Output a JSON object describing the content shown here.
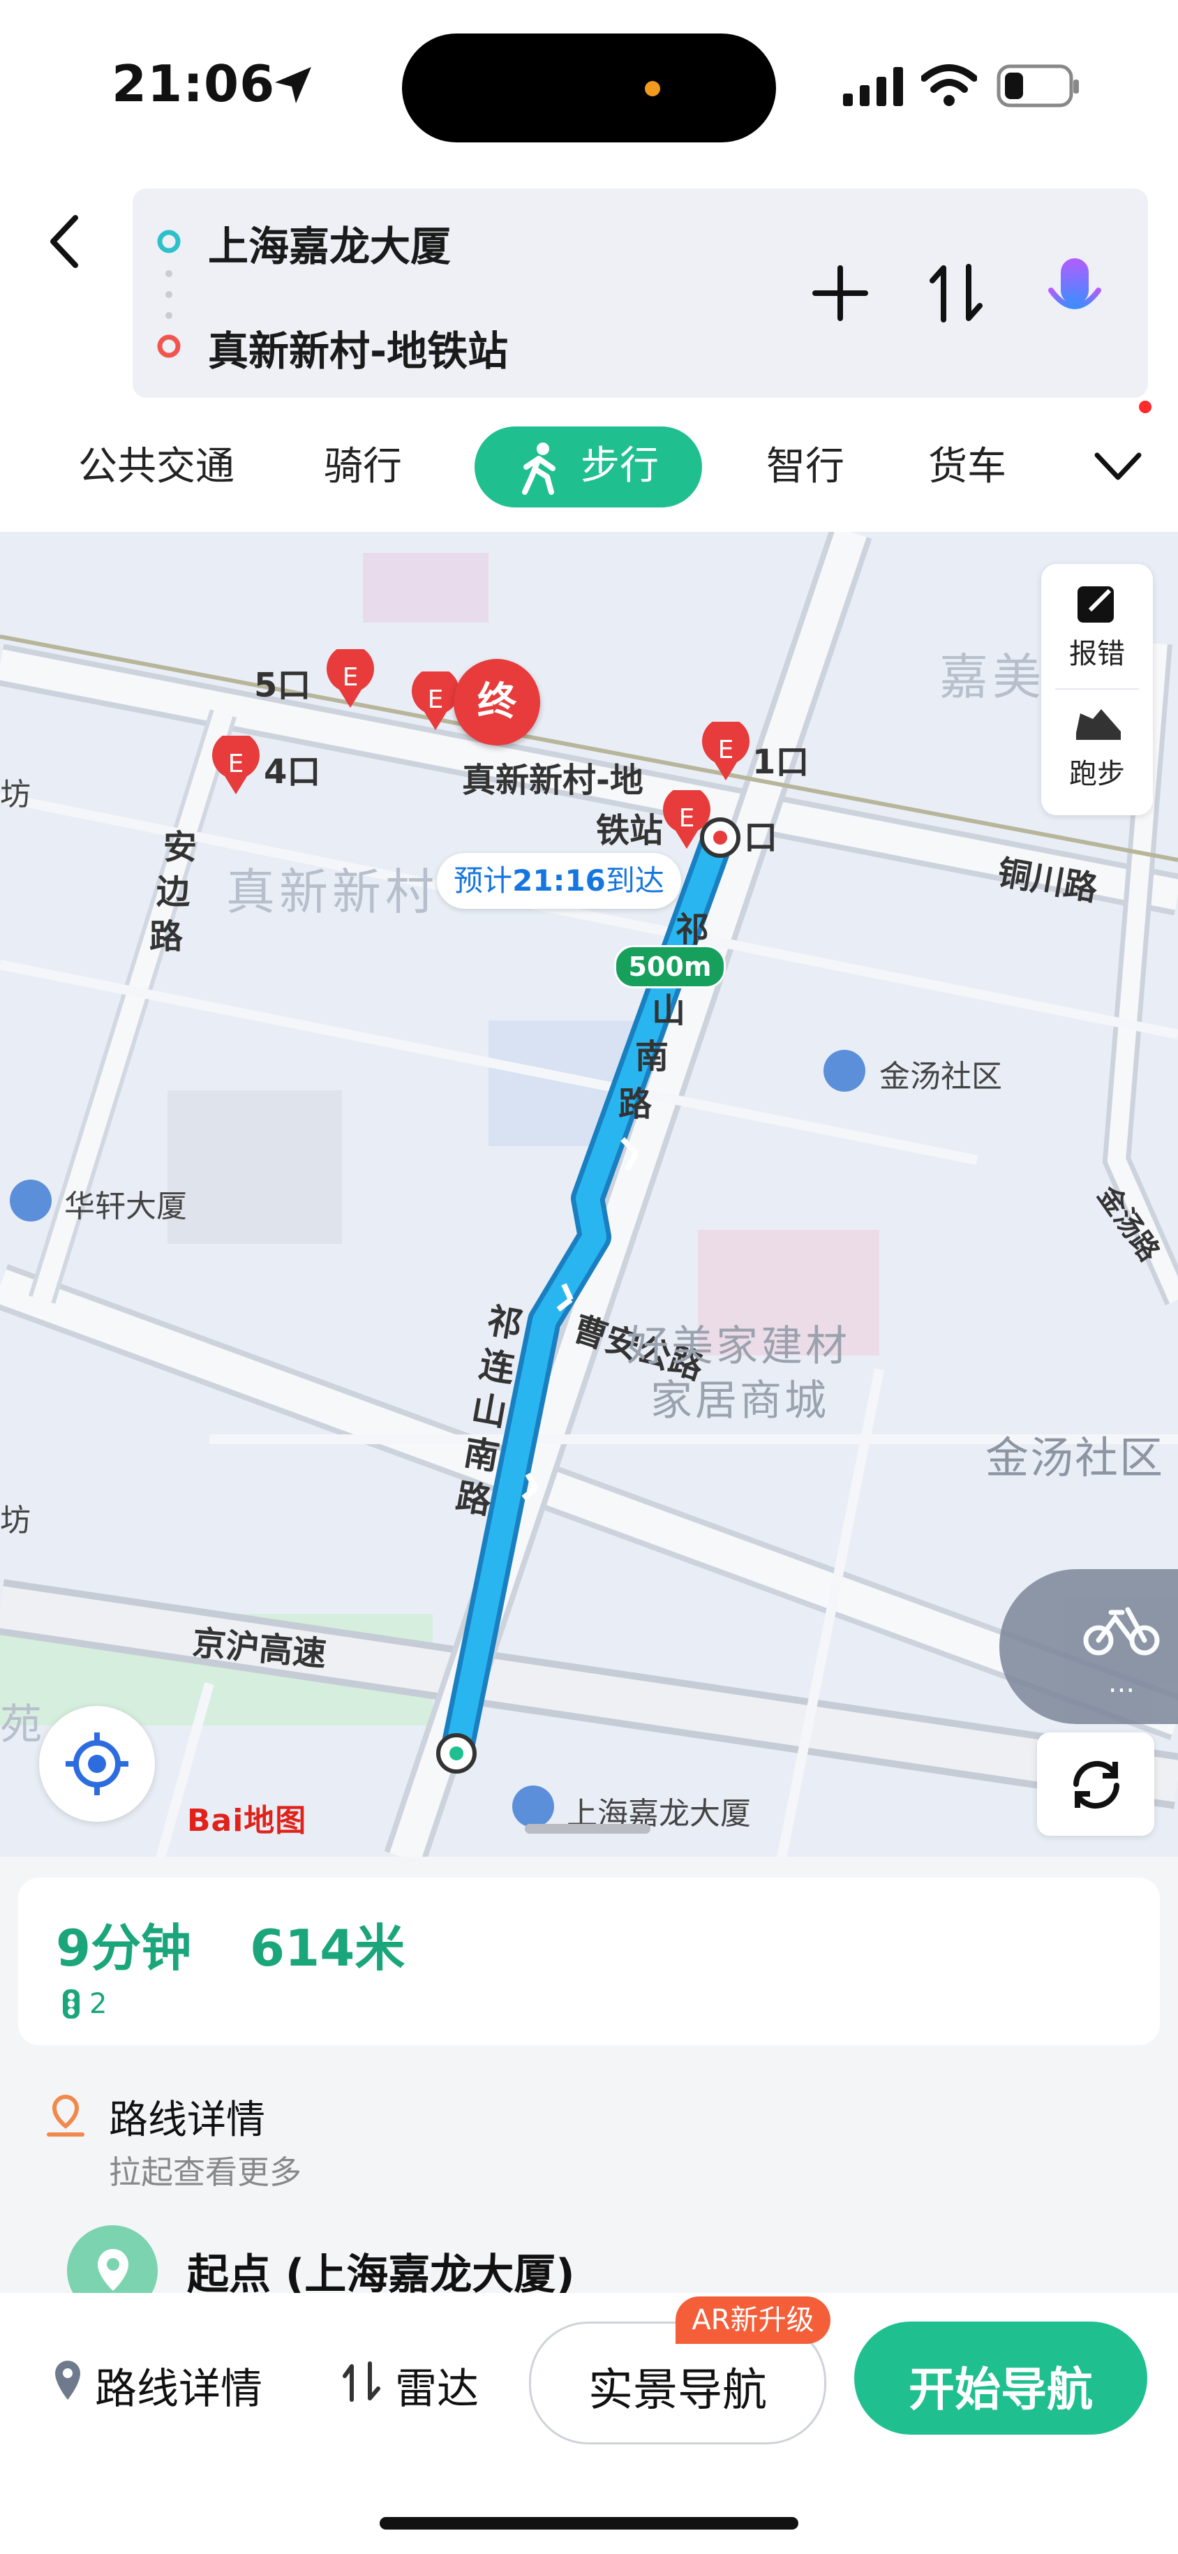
{
  "status_bar": {
    "time": "21:06"
  },
  "route": {
    "origin": "上海嘉龙大厦",
    "destination": "真新新村-地铁站"
  },
  "modes": {
    "transit": "公共交通",
    "cycling": "骑行",
    "walking": "步行",
    "smart": "智行",
    "truck": "货车"
  },
  "map": {
    "exit_5": "5口",
    "exit_4": "4口",
    "exit_1": "1口",
    "exit_2": "口",
    "end_marker": "终",
    "dest_station": "真新新村-地",
    "dest_station_2": "铁站",
    "eta_prefix": "预计",
    "eta_time": "21:16",
    "eta_suffix": "到达",
    "distance_badge": "500m",
    "area_zhenxin": "真新新村",
    "area_jinmei": "嘉美",
    "road_tongchuan": "铜川路",
    "road_anbian_1": "安",
    "road_anbian_2": "边",
    "road_anbian_3": "路",
    "road_qilian_top_1": "祁",
    "road_qilian_top_2": "山",
    "road_qilian_top_3": "南",
    "road_qilian_top_4": "路",
    "road_qilian_bot": "祁连山南路",
    "road_caoan": "曹安公路",
    "road_jinghu": "京沪高速",
    "poi_jintang_1": "金汤社区",
    "poi_jintang_2": "金汤社区",
    "poi_huaxuan": "华轩大厦",
    "poi_haomeijia_1": "好美家建材",
    "poi_haomeijia_2": "家居商城",
    "poi_jialong": "上海嘉龙大厦",
    "poi_fang_1": "坊",
    "poi_fang_2": "坊",
    "poi_yuan": "苑",
    "road_jintang": "金汤路",
    "report_error": "报错",
    "running": "跑步",
    "bike_more": "...",
    "logo": "Bai地图"
  },
  "summary": {
    "duration": "9分钟",
    "distance": "614米",
    "traffic_lights": "2"
  },
  "details": {
    "title": "路线详情",
    "hint": "拉起查看更多",
    "start_point": "起点 (上海嘉龙大厦)"
  },
  "bottom_bar": {
    "details": "路线详情",
    "radar": "雷达",
    "ar_badge": "AR新升级",
    "ar_nav": "实景导航",
    "start_nav": "开始导航"
  },
  "colors": {
    "accent_green": "#1fbf8f",
    "route_blue": "#29b6f0",
    "marker_red": "#e83b3b"
  }
}
